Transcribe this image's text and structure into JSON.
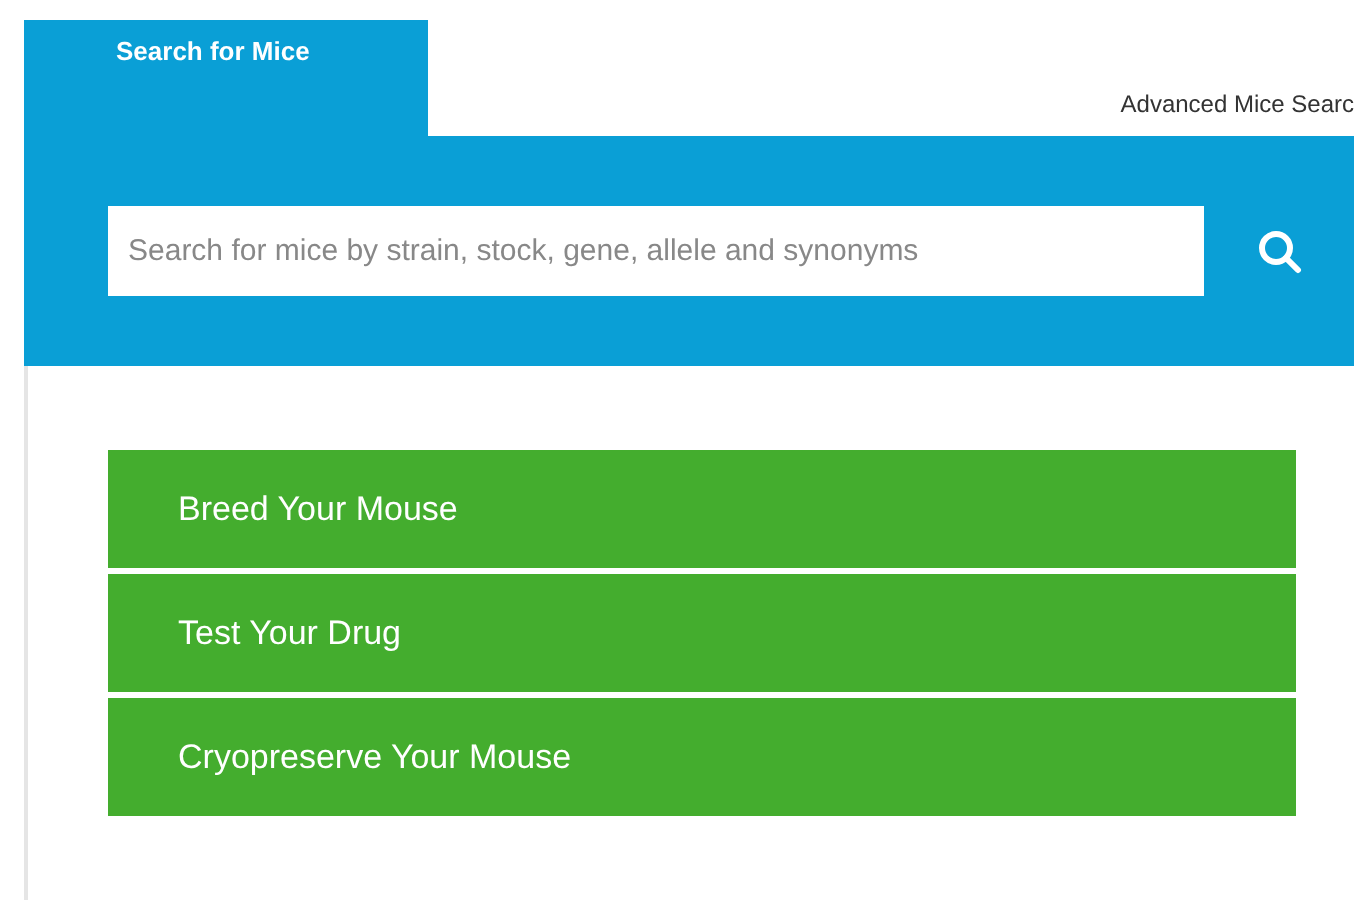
{
  "tabs": [
    {
      "label": "Search for Mice",
      "selected": true
    },
    {
      "label": "Advanced Mice Searc",
      "selected": false
    }
  ],
  "search": {
    "placeholder": "Search for mice by strain, stock, gene, allele and synonyms"
  },
  "services": [
    {
      "label": "Breed Your Mouse"
    },
    {
      "label": "Test Your Drug"
    },
    {
      "label": "Cryopreserve Your Mouse"
    }
  ]
}
